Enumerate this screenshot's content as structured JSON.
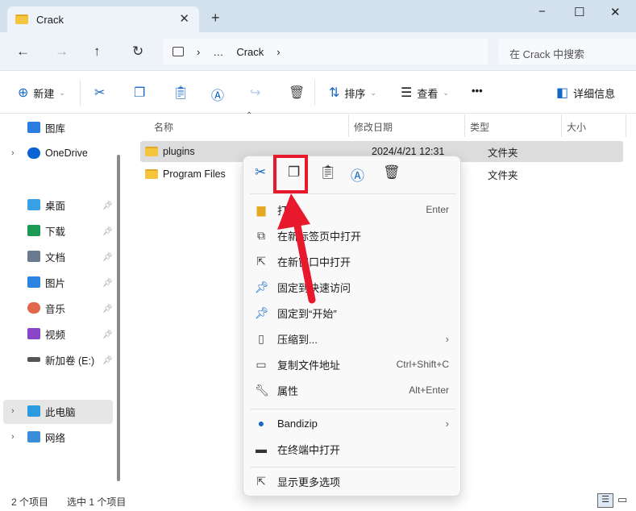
{
  "window": {
    "tab_title": "Crack",
    "new_tab": "+",
    "minimize": "−",
    "maximize": "☐",
    "close": "✕"
  },
  "nav": {
    "back": "←",
    "forward": "→",
    "up": "↑",
    "refresh": "↻",
    "breadcrumb": [
      "…",
      "Crack"
    ],
    "search_placeholder": "在 Crack 中搜索"
  },
  "toolbar": {
    "new": "新建",
    "sort": "排序",
    "view": "查看",
    "more": "•••",
    "details": "详细信息"
  },
  "sidebar": {
    "items": [
      {
        "label": "图库",
        "color": "#2a7de1"
      },
      {
        "label": "OneDrive",
        "color": "#0a64d6"
      },
      {
        "label": "桌面",
        "color": "#3aa0e6",
        "pinned": true
      },
      {
        "label": "下载",
        "color": "#1a9a55",
        "pinned": true
      },
      {
        "label": "文档",
        "color": "#6a7b90",
        "pinned": true
      },
      {
        "label": "图片",
        "color": "#2b84e0",
        "pinned": true
      },
      {
        "label": "音乐",
        "color": "#e2664c",
        "pinned": true
      },
      {
        "label": "视频",
        "color": "#8a46c9",
        "pinned": true
      },
      {
        "label": "新加卷 (E:)",
        "color": "#555555",
        "pinned": true
      },
      {
        "label": "此电脑",
        "color": "#2b9ae0",
        "selected": true
      },
      {
        "label": "网络",
        "color": "#3a8dd8"
      }
    ]
  },
  "columns": {
    "name": "名称",
    "modified": "修改日期",
    "type": "类型",
    "size": "大小"
  },
  "files": [
    {
      "name": "plugins",
      "modified": "2024/4/21 12:31",
      "type": "文件夹",
      "selected": true
    },
    {
      "name": "Program Files",
      "modified": "",
      "type": "文件夹"
    }
  ],
  "status": {
    "count": "2 个项目",
    "selected": "选中 1 个项目"
  },
  "context_menu": {
    "items": [
      {
        "label": "打开",
        "shortcut": "Enter",
        "icon": "folder-open-icon"
      },
      {
        "label": "在新标签页中打开",
        "icon": "new-tab-icon"
      },
      {
        "label": "在新窗口中打开",
        "icon": "new-window-icon"
      },
      {
        "label": "固定到快速访问",
        "icon": "pin-icon"
      },
      {
        "label": "固定到“开始”",
        "icon": "pin-icon"
      },
      {
        "label": "压缩到...",
        "icon": "zip-icon",
        "submenu": true
      },
      {
        "label": "复制文件地址",
        "shortcut": "Ctrl+Shift+C",
        "icon": "copy-path-icon"
      },
      {
        "label": "属性",
        "shortcut": "Alt+Enter",
        "icon": "wrench-icon"
      },
      {
        "label": "Bandizip",
        "icon": "bandizip-icon",
        "submenu": true
      },
      {
        "label": "在终端中打开",
        "icon": "terminal-icon"
      },
      {
        "label": "显示更多选项",
        "icon": "more-options-icon"
      }
    ]
  },
  "annotation": {
    "color": "#e8192c",
    "target": "copy"
  }
}
